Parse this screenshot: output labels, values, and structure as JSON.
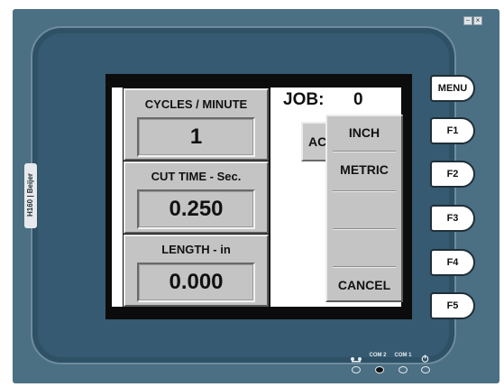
{
  "window_controls": {
    "minimize": "–",
    "close": "×"
  },
  "brand": {
    "text": "H160 | Beijer"
  },
  "panels": [
    {
      "title": "CYCLES / MINUTE",
      "value": "1"
    },
    {
      "title": "CUT TIME - Sec.",
      "value": "0.250"
    },
    {
      "title": "LENGTH - in",
      "value": "0.000"
    }
  ],
  "job": {
    "label": "JOB:",
    "value": "0"
  },
  "partial_button": {
    "label": "AC"
  },
  "dropdown": {
    "items": [
      "INCH",
      "METRIC",
      "",
      "",
      "CANCEL"
    ]
  },
  "function_keys": [
    "MENU",
    "F1",
    "F2",
    "F3",
    "F4",
    "F5"
  ],
  "status": {
    "labels": [
      "COM 2",
      "COM 1"
    ],
    "network_icon": "network-icon",
    "power_icon": "power-icon"
  }
}
